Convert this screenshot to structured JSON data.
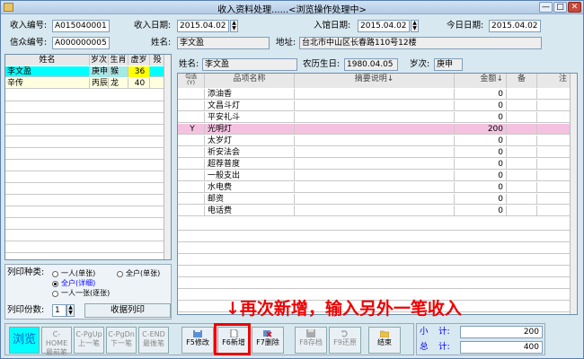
{
  "window": {
    "title": "收入资料处理......<浏览操作处理中>",
    "min": "—",
    "max": "□",
    "close": "✕"
  },
  "form": {
    "receipt_no_label": "收入编号:",
    "receipt_no": "A015040001",
    "receipt_date_label": "收入日期:",
    "receipt_date": "2015.04.02",
    "entry_date_label": "入馆日期:",
    "entry_date": "2015.04.02",
    "today_label": "今日日期:",
    "today": "2015.04.02",
    "believer_no_label": "信众编号:",
    "believer_no": "A000000005",
    "name_label": "姓名:",
    "name": "李文盈",
    "address_label": "地址:",
    "address": "台北市中山区长春路110号12楼"
  },
  "left_table": {
    "headers": [
      "姓名",
      "岁次",
      "生肖",
      "虚岁",
      "殁"
    ],
    "rows": [
      {
        "name": "李文盈",
        "year": "庚申",
        "zodiac": "猴",
        "age": "36",
        "dead": ""
      },
      {
        "name": "辛传",
        "year": "丙辰",
        "zodiac": "龙",
        "age": "40",
        "dead": ""
      }
    ]
  },
  "detail": {
    "name_label": "姓名:",
    "name": "李文盈",
    "lunar_label": "农历生日:",
    "lunar": "1980.04.05",
    "year_label": "岁次:",
    "year": "庚申"
  },
  "right_table": {
    "headers": [
      "勾选\n(Y)",
      "品项名称",
      "摘要说明↓",
      "金额↓",
      "备",
      "注"
    ],
    "rows": [
      {
        "check": "",
        "item": "添油香",
        "amount": "0",
        "highlight": false
      },
      {
        "check": "",
        "item": "文昌斗灯",
        "amount": "0",
        "highlight": false
      },
      {
        "check": "",
        "item": "平安礼斗",
        "amount": "0",
        "highlight": false
      },
      {
        "check": "Y",
        "item": "光明灯",
        "amount": "200",
        "highlight": true
      },
      {
        "check": "",
        "item": "太岁灯",
        "amount": "0",
        "highlight": false
      },
      {
        "check": "",
        "item": "祈安法会",
        "amount": "0",
        "highlight": false
      },
      {
        "check": "",
        "item": "超荐普度",
        "amount": "0",
        "highlight": false
      },
      {
        "check": "",
        "item": "一般支出",
        "amount": "0",
        "highlight": false
      },
      {
        "check": "",
        "item": "水电费",
        "amount": "0",
        "highlight": false
      },
      {
        "check": "",
        "item": "邮资",
        "amount": "0",
        "highlight": false
      },
      {
        "check": "",
        "item": "电话费",
        "amount": "0",
        "highlight": false
      }
    ]
  },
  "print": {
    "type_label": "列印种类:",
    "opt1": "一人(单张)",
    "opt2": "全户(单张)",
    "opt3": "全户(详细)",
    "opt4": "一人一张(逐张)",
    "copies_label": "列印份数:",
    "copies": "1",
    "print_button": "收据列印"
  },
  "toolbar": {
    "browse": "浏览",
    "first_key": "C-HOME",
    "first": "最前笔",
    "prev_key": "C-PgUp",
    "prev": "上一笔",
    "next_key": "C-PgDn",
    "next": "下一笔",
    "last_key": "C-END",
    "last": "最後笔",
    "edit": "F5修改",
    "add": "F6新增",
    "del": "F7删除",
    "save": "F8存档",
    "restore": "F9还原",
    "end": "结束"
  },
  "summary": {
    "sub_label": "小",
    "sub_label2": "计:",
    "sub": "200",
    "total_label": "总",
    "total_label2": "计:",
    "total": "400"
  },
  "annotation": "↓再次新增，输入另外一笔收入",
  "colors": {
    "selected_row": "#00ffff",
    "highlight_row": "#f4c2e0",
    "annotation": "#e00000"
  }
}
